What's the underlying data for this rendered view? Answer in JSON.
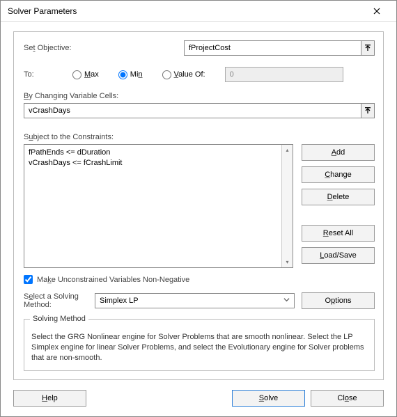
{
  "window": {
    "title": "Solver Parameters"
  },
  "objective": {
    "label": "Set Objective:",
    "value": "fProjectCost"
  },
  "to": {
    "label": "To:",
    "max": "Max",
    "min": "Min",
    "valueof": "Value Of:",
    "numeric": "0",
    "selected": "min"
  },
  "changing": {
    "label": "By Changing Variable Cells:",
    "value": "vCrashDays"
  },
  "constraints": {
    "label": "Subject to the Constraints:",
    "items": [
      "fPathEnds <= dDuration",
      "vCrashDays <= fCrashLimit"
    ]
  },
  "side": {
    "add": "Add",
    "change": "Change",
    "delete": "Delete",
    "resetall": "Reset All",
    "loadsave": "Load/Save"
  },
  "checkbox": {
    "label": "Make Unconstrained Variables Non-Negative",
    "checked": true
  },
  "method": {
    "label": "Select a Solving Method:",
    "value": "Simplex LP",
    "options_btn": "Options"
  },
  "desc": {
    "legend": "Solving Method",
    "body": "Select the GRG Nonlinear engine for Solver Problems that are smooth nonlinear. Select the LP Simplex engine for linear Solver Problems, and select the Evolutionary engine for Solver problems that are non-smooth."
  },
  "buttons": {
    "help": "Help",
    "solve": "Solve",
    "close": "Close"
  }
}
